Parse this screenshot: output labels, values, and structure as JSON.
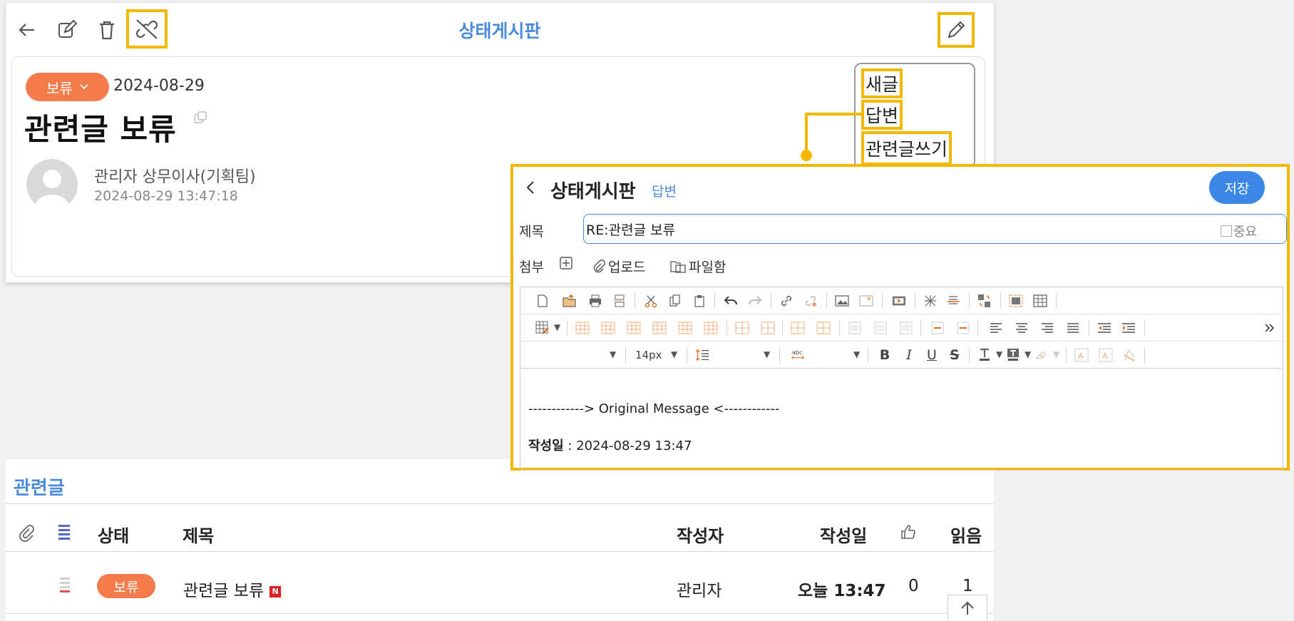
{
  "board": {
    "title": "상태게시판"
  },
  "post": {
    "status": "보류",
    "date": "2024-08-29",
    "title": "관련글 보류",
    "author": "관리자 상무이사(기획팀)",
    "datetime": "2024-08-29 13:47:18"
  },
  "dropdown": {
    "items": [
      "새글",
      "답변",
      "관련글쓰기"
    ]
  },
  "editor": {
    "title": "상태게시판",
    "mode": "답변",
    "save_label": "저장",
    "subject_label": "제목",
    "subject_value": "RE:관련글 보류",
    "important_label": "중요",
    "attach_label": "첨부",
    "upload_label": "업로드",
    "filebox_label": "파일함",
    "font_size": "14px",
    "body_line1": "------------> Original Message <------------",
    "body_written_label": "작성일",
    "body_written_value": " : 2024-08-29 13:47"
  },
  "related": {
    "title": "관련글",
    "columns": {
      "status": "상태",
      "subject": "제목",
      "author": "작성자",
      "date": "작성일",
      "read": "읽음"
    },
    "rows": [
      {
        "status": "보류",
        "subject": "관련글 보류",
        "badge": "N",
        "author": "관리자",
        "date": "오늘 13:47",
        "likes": "0",
        "reads": "1"
      }
    ]
  },
  "colors": {
    "accent_blue": "#4a8cdb",
    "status_orange": "#f47c4c",
    "highlight_yellow": "#f5b800",
    "save_blue": "#3a87e8"
  }
}
